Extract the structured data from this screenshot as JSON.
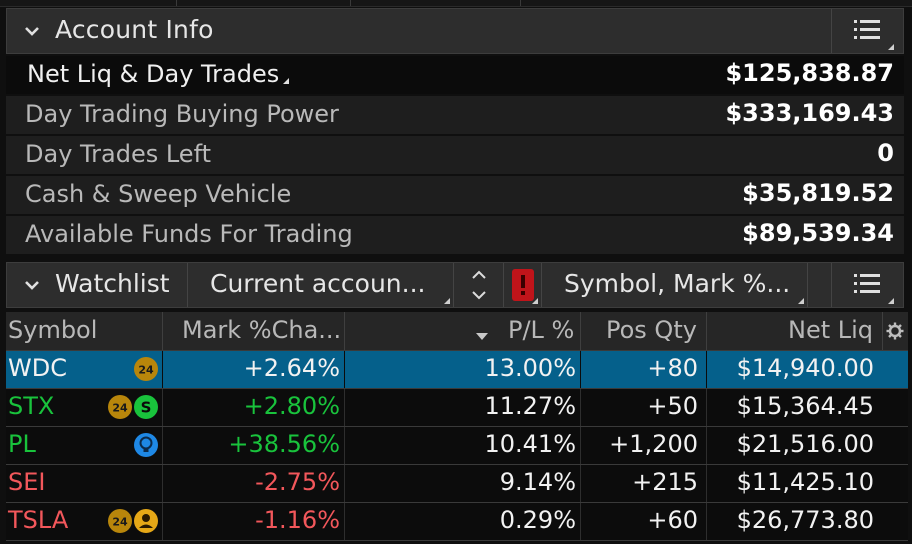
{
  "account": {
    "title": "Account Info",
    "rows": [
      {
        "label": "Net Liq & Day Trades",
        "value": "$125,838.87"
      },
      {
        "label": "Day Trading Buying Power",
        "value": "$333,169.43"
      },
      {
        "label": "Day Trades Left",
        "value": "0"
      },
      {
        "label": "Cash & Sweep Vehicle",
        "value": "$35,819.52"
      },
      {
        "label": "Available Funds For Trading",
        "value": "$89,539.34"
      }
    ]
  },
  "watchlist": {
    "title": "Watchlist",
    "list_selector": "Current accoun...",
    "columns_selector": "Symbol, Mark %...",
    "columns": [
      "Symbol",
      "Mark %Cha...",
      "P/L %",
      "Pos Qty",
      "Net Liq"
    ],
    "rows": [
      {
        "symbol": "WDC",
        "mark_change": "+2.64%",
        "pl_pct": "13.00%",
        "pos_qty": "+80",
        "net_liq": "$14,940.00",
        "badges": [
          "24"
        ]
      },
      {
        "symbol": "STX",
        "mark_change": "+2.80%",
        "pl_pct": "11.27%",
        "pos_qty": "+50",
        "net_liq": "$15,364.45",
        "badges": [
          "24",
          "S"
        ]
      },
      {
        "symbol": "PL",
        "mark_change": "+38.56%",
        "pl_pct": "10.41%",
        "pos_qty": "+1,200",
        "net_liq": "$21,516.00",
        "badges": [
          "bulb"
        ]
      },
      {
        "symbol": "SEI",
        "mark_change": "-2.75%",
        "pl_pct": "9.14%",
        "pos_qty": "+215",
        "net_liq": "$11,425.10",
        "badges": []
      },
      {
        "symbol": "TSLA",
        "mark_change": "-1.16%",
        "pl_pct": "0.29%",
        "pos_qty": "+60",
        "net_liq": "$26,773.80",
        "badges": [
          "24",
          "person"
        ]
      }
    ]
  },
  "colors": {
    "selected_row": "#05608b",
    "positive": "#19c33c",
    "negative": "#f2575b",
    "badge_24": "#b8860b",
    "badge_s": "#19c33c",
    "badge_bulb": "#1e88e5",
    "alert": "#c0141a"
  },
  "icons": [
    "chevron-down-icon",
    "menu-icon",
    "up-down-arrows-icon",
    "alert-icon",
    "gear-icon",
    "sort-down-icon",
    "earnings-24-icon",
    "dividend-s-icon",
    "bulb-icon",
    "person-icon"
  ]
}
